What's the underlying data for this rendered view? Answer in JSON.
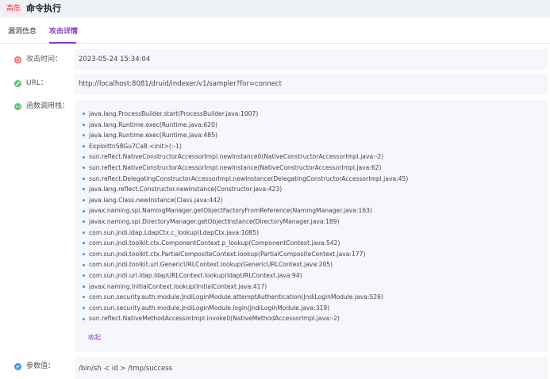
{
  "header": {
    "badge": "高危",
    "title": "命令执行"
  },
  "tabs": [
    {
      "label": "漏洞信息",
      "active": false
    },
    {
      "label": "攻击详情",
      "active": true
    }
  ],
  "colors": {
    "accent": "#8c3bc9",
    "danger": "#e8344e",
    "bullet": "#3c93f0"
  },
  "attack_time": {
    "label": "攻击时间：",
    "icon": "clock-icon",
    "value": "2023-05-24 15:34:04"
  },
  "url": {
    "label": "URL：",
    "icon": "link-icon",
    "value": "http://localhost:8081/druid/indexer/v1/sampler?for=connect"
  },
  "call_stack": {
    "label": "函数调用栈：",
    "icon": "code-icon",
    "frames": [
      "java.lang.ProcessBuilder.start(ProcessBuilder.java:1007)",
      "java.lang.Runtime.exec(Runtime.java:620)",
      "java.lang.Runtime.exec(Runtime.java:485)",
      "ExploittnS8Gu7Ca8.<init>(:-1)",
      "sun.reflect.NativeConstructorAccessorImpl.newInstance0(NativeConstructorAccessorImpl.java:-2)",
      "sun.reflect.NativeConstructorAccessorImpl.newInstance(NativeConstructorAccessorImpl.java:62)",
      "sun.reflect.DelegatingConstructorAccessorImpl.newInstance(DelegatingConstructorAccessorImpl.java:45)",
      "java.lang.reflect.Constructor.newInstance(Constructor.java:423)",
      "java.lang.Class.newInstance(Class.java:442)",
      "javax.naming.spi.NamingManager.getObjectFactoryFromReference(NamingManager.java:163)",
      "javax.naming.spi.DirectoryManager.getObjectInstance(DirectoryManager.java:189)",
      "com.sun.jndi.ldap.LdapCtx.c_lookup(LdapCtx.java:1085)",
      "com.sun.jndi.toolkit.ctx.ComponentContext.p_lookup(ComponentContext.java:542)",
      "com.sun.jndi.toolkit.ctx.PartialCompositeContext.lookup(PartialCompositeContext.java:177)",
      "com.sun.jndi.toolkit.url.GenericURLContext.lookup(GenericURLContext.java:205)",
      "com.sun.jndi.url.ldap.ldapURLContext.lookup(ldapURLContext.java:94)",
      "javax.naming.InitialContext.lookup(InitialContext.java:417)",
      "com.sun.security.auth.module.JndiLoginModule.attemptAuthentication(JndiLoginModule.java:526)",
      "com.sun.security.auth.module.JndiLoginModule.login(JndiLoginModule.java:319)",
      "sun.reflect.NativeMethodAccessorImpl.invoke0(NativeMethodAccessorImpl.java:-2)"
    ],
    "collapse_label": "收起"
  },
  "params": {
    "label": "参数值：",
    "icon": "params-icon",
    "value": "/bin/sh -c id > /tmp/success"
  }
}
